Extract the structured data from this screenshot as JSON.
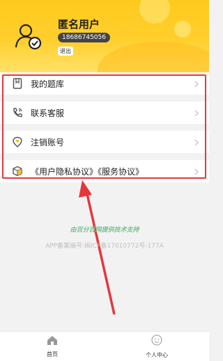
{
  "header": {
    "username": "匿名用户",
    "phone": "18686745056",
    "logout_label": "退出"
  },
  "menu": {
    "items": [
      {
        "label": "我的题库",
        "icon": "book-icon"
      },
      {
        "label": "联系客服",
        "icon": "phone-icon"
      },
      {
        "label": "注销账号",
        "icon": "location-heart-icon"
      },
      {
        "label": "《用户隐私协议》《服务协议》",
        "icon": "cube-icon"
      }
    ]
  },
  "footer": {
    "support_text": "由百分百网提供技术支持",
    "icp_text": "APP备案编号:闽ICP备17010772号-177A"
  },
  "tabbar": {
    "tabs": [
      {
        "label": "首页",
        "icon": "home-icon"
      },
      {
        "label": "个人中心",
        "icon": "smiley-icon"
      }
    ]
  },
  "colors": {
    "header_yellow": "#ffca1f",
    "annotation_red": "#e6363c"
  }
}
